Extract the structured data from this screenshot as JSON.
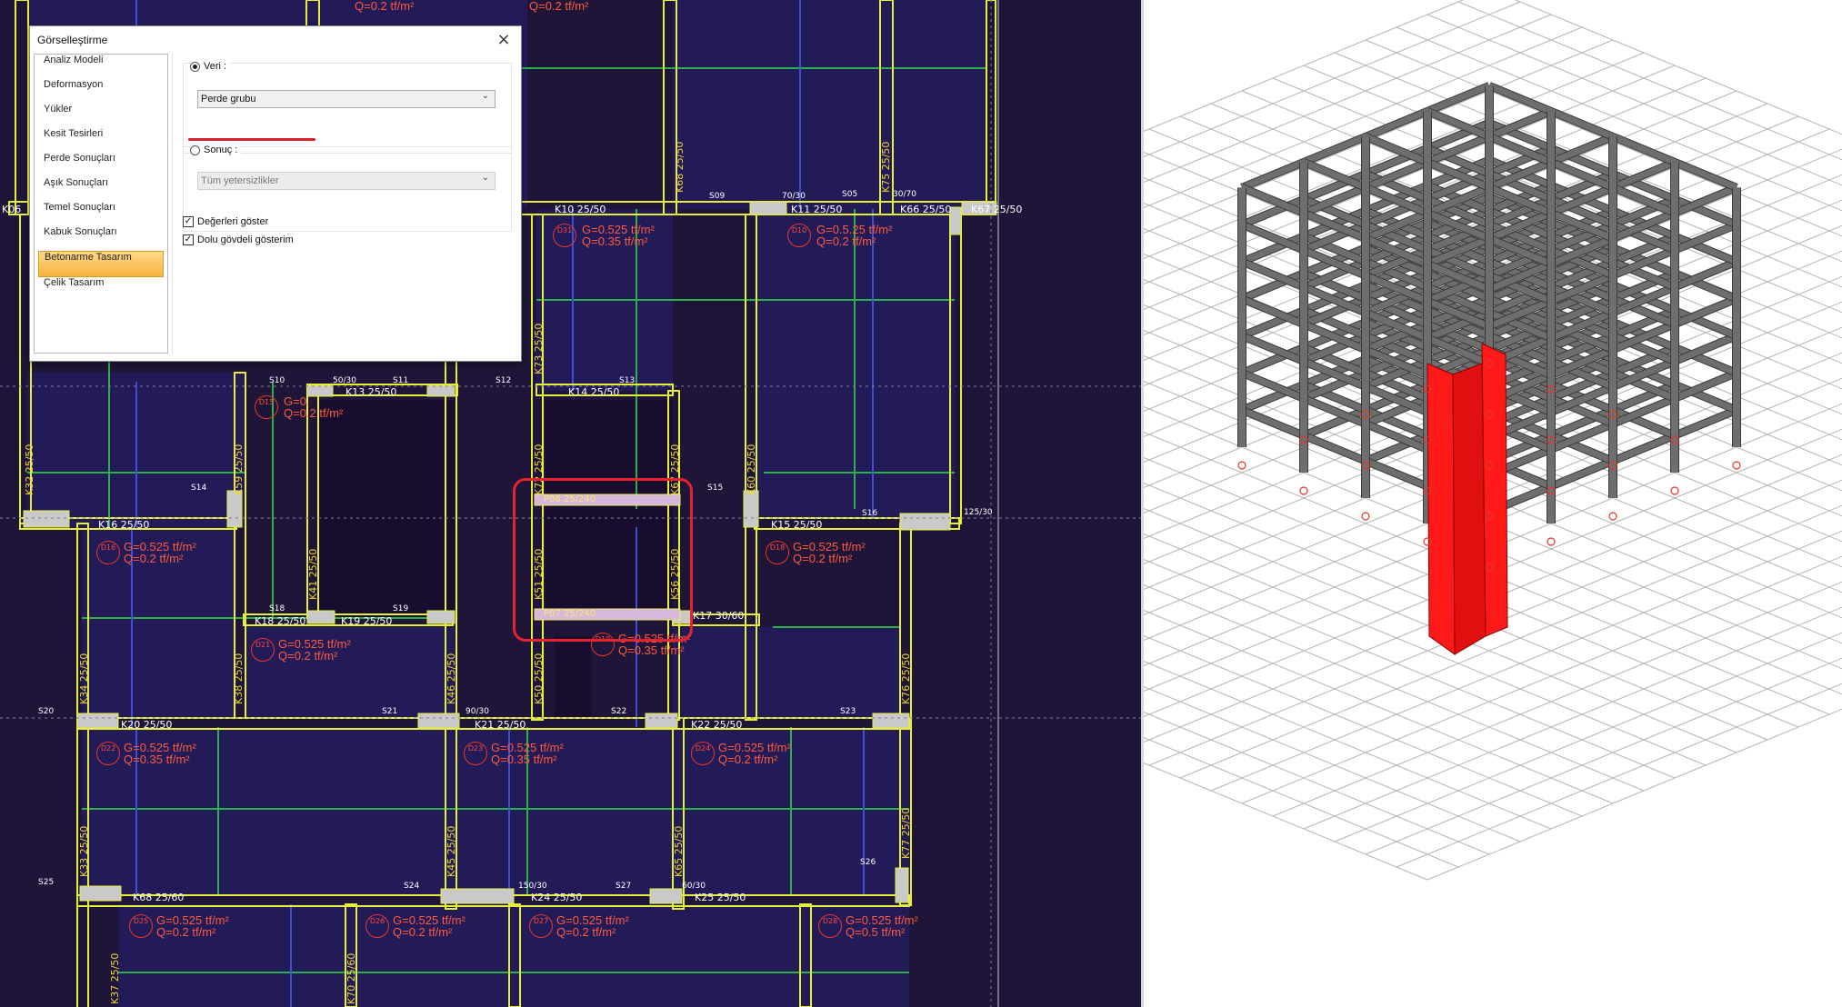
{
  "dialog": {
    "title": "Görselleştirme",
    "close_icon": "close-icon",
    "nav": [
      {
        "label": "Analiz Modeli"
      },
      {
        "label": "Deformasyon"
      },
      {
        "label": "Yükler"
      },
      {
        "label": "Kesit Tesirleri"
      },
      {
        "label": "Perde Sonuçları"
      },
      {
        "label": "Aşık Sonuçları"
      },
      {
        "label": "Temel Sonuçları"
      },
      {
        "label": "Kabuk Sonuçları"
      },
      {
        "label": "Betonarme Tasarım",
        "active": true
      },
      {
        "label": "Çelik Tasarım"
      }
    ],
    "veri": {
      "label": "Veri :",
      "selected": true,
      "value": "Perde grubu"
    },
    "sonuc": {
      "label": "Sonuç :",
      "selected": false,
      "value": "Tüm yetersizlikler"
    },
    "show_values": {
      "label": "Değerleri göster",
      "checked": true
    },
    "solid_body": {
      "label": "Dolu gövdeli gösterim",
      "checked": true
    }
  },
  "plan": {
    "beams": [
      {
        "label": "K10 25/50"
      },
      {
        "label": "K11 25/50"
      },
      {
        "label": "K66 25/50"
      },
      {
        "label": "K67 25/50"
      },
      {
        "label": "K06"
      },
      {
        "label": "K13 25/50"
      },
      {
        "label": "K14 25/50"
      },
      {
        "label": "K16 25/50"
      },
      {
        "label": "K15 25/50"
      },
      {
        "label": "K18 25/50"
      },
      {
        "label": "K19 25/50"
      },
      {
        "label": "K17 30/60"
      },
      {
        "label": "K20 25/50"
      },
      {
        "label": "K21 25/50"
      },
      {
        "label": "K22 25/50"
      },
      {
        "label": "K68 25/60"
      },
      {
        "label": "K24 25/50"
      },
      {
        "label": "K25 25/50"
      }
    ],
    "columns": [
      {
        "label": "K68 25/50"
      },
      {
        "label": "K75 25/50"
      },
      {
        "label": "K73 25/50"
      },
      {
        "label": "K72 25/50"
      },
      {
        "label": "K67 25/50"
      },
      {
        "label": "K60 25/50"
      },
      {
        "label": "K59 25/50"
      },
      {
        "label": "K32 25/50"
      },
      {
        "label": "K41 25/50"
      },
      {
        "label": "K51 25/50"
      },
      {
        "label": "K56 25/50"
      },
      {
        "label": "K34 25/50"
      },
      {
        "label": "K38 25/50"
      },
      {
        "label": "K46 25/50"
      },
      {
        "label": "K50 25/50"
      },
      {
        "label": "K76 25/50"
      },
      {
        "label": "K33 25/50"
      },
      {
        "label": "K45 25/50"
      },
      {
        "label": "K65 25/50"
      },
      {
        "label": "K77 25/50"
      },
      {
        "label": "K37 25/50"
      },
      {
        "label": "K70 25/60"
      }
    ],
    "slabs": [
      "S09",
      "S05",
      "S10",
      "S11",
      "S12",
      "S13",
      "S14",
      "S15",
      "S16",
      "S18",
      "S19",
      "S20",
      "S21",
      "S22",
      "S23",
      "S24",
      "S25",
      "S26",
      "S27"
    ],
    "loads": [
      {
        "tag": "D31",
        "g": "G=0.525 tf/m²",
        "q": "Q=0.35 tf/m²"
      },
      {
        "tag": "D10",
        "g": "G=0.5.25 tf/m²",
        "q": "Q=0.2 tf/m²"
      },
      {
        "tag": "D15",
        "g": "G=0.",
        "q": "Q=0.2 tf/m²"
      },
      {
        "tag": "D16",
        "g": "G=0.525 tf/m²",
        "q": "Q=0.2 tf/m²"
      },
      {
        "tag": "D18",
        "g": "G=0.525 tf/m²",
        "q": "Q=0.2 tf/m²"
      },
      {
        "tag": "D21",
        "g": "G=0.525 tf/m²",
        "q": "Q=0.2 tf/m²"
      },
      {
        "tag": "D19",
        "g": "G=0.525 tf/m²",
        "q": "Q=0.35 tf/m²"
      },
      {
        "tag": "D22",
        "g": "G=0.525 tf/m²",
        "q": "Q=0.35 tf/m²"
      },
      {
        "tag": "D23",
        "g": "G=0.525 tf/m²",
        "q": "Q=0.35 tf/m²"
      },
      {
        "tag": "D24",
        "g": "G=0.525 tf/m²",
        "q": "Q=0.2 tf/m²"
      },
      {
        "tag": "D25",
        "g": "G=0.525 tf/m²",
        "q": "Q=0.2 tf/m²"
      },
      {
        "tag": "D26",
        "g": "G=0.525 tf/m²",
        "q": "Q=0.2 tf/m²"
      },
      {
        "tag": "D27",
        "g": "G=0.525 tf/m²",
        "q": "Q=0.2 tf/m²"
      },
      {
        "tag": "D28",
        "g": "G=0.525 tf/m²",
        "q": "Q=0.5 tf/m²"
      }
    ],
    "top_load_q": "Q=0.2 tf/m²",
    "walls": [
      "P06 25/240",
      "P07 25/240"
    ],
    "dims": [
      "70/30",
      "30/70",
      "50/30",
      "125/30",
      "90/30",
      "150/30",
      "60/30"
    ],
    "colors": {
      "background": "#1e1538",
      "beam": "#e8ef3a",
      "grid": "#2bb04a",
      "highlight": "#e8222f",
      "wall_3d": "#ff1a1a"
    }
  },
  "view3d": {
    "colors": {
      "frame": "#5a5a5a",
      "wall": "#ff1a1a",
      "grid": "#b0b0b0"
    }
  }
}
